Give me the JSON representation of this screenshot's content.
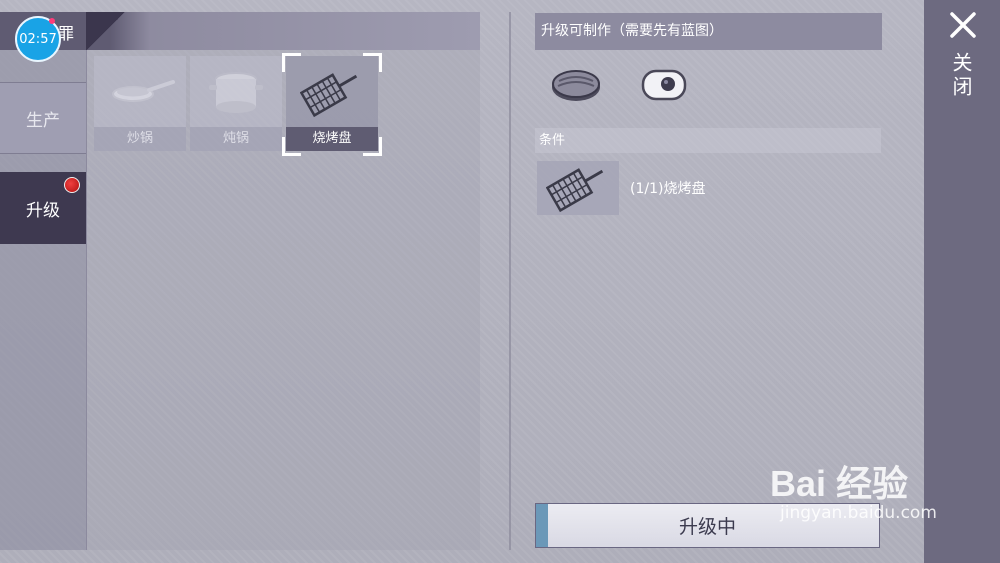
{
  "status": {
    "clock": "02:57",
    "header_trail": "罪"
  },
  "tabs": [
    {
      "label": "生产",
      "active": false
    },
    {
      "label": "升级",
      "active": true,
      "has_badge": true
    }
  ],
  "items": [
    {
      "label": "炒锅",
      "icon": "frying-pan-icon"
    },
    {
      "label": "炖锅",
      "icon": "stew-pot-icon"
    },
    {
      "label": "烧烤盘",
      "icon": "grill-basket-icon",
      "selected": true
    }
  ],
  "detail": {
    "craftable_header": "升级可制作（需要先有蓝图）",
    "craftable_icons": [
      "steak-icon",
      "fried-egg-icon"
    ],
    "conditions_header": "条件",
    "condition_item": {
      "icon": "grill-basket-icon",
      "text": "(1/1)烧烤盘"
    },
    "upgrade_button": "升级中",
    "upgrade_progress": 0.035
  },
  "close": {
    "label": "关闭"
  },
  "watermark": {
    "main": "Bai 经验",
    "sub": "jingyan.baidu.com"
  },
  "colors": {
    "accent_blue": "#19a3e6",
    "badge_red": "#d02020",
    "active_tab": "#3e3950"
  }
}
